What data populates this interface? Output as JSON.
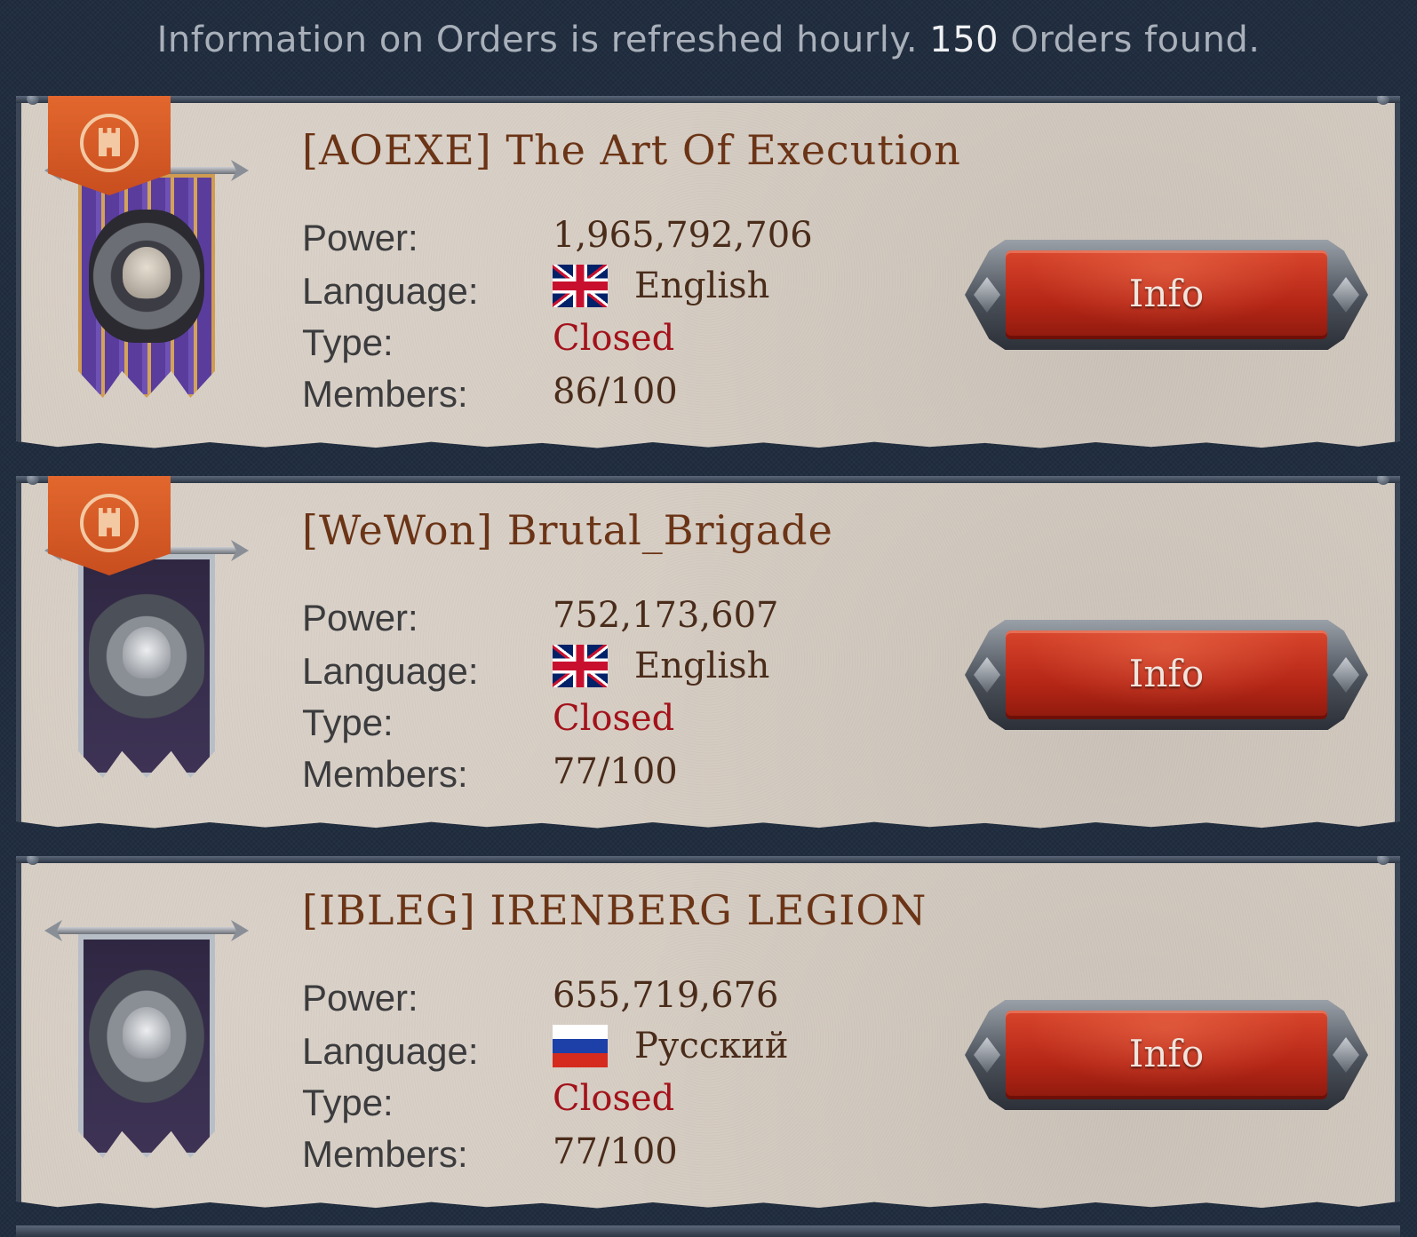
{
  "header": {
    "text_before": "Information on Orders is refreshed hourly.",
    "count": "150",
    "text_after": "Orders found."
  },
  "labels": {
    "power": "Power:",
    "language": "Language:",
    "type": "Type:",
    "members": "Members:"
  },
  "orders": [
    {
      "title": "[AOEXE] The Art Of Execution",
      "power": "1,965,792,706",
      "language": "English",
      "flag": "uk-flag-icon",
      "type": "Closed",
      "members": "86/100",
      "button": "Info",
      "banner": "skull-banner-icon",
      "has_castle_tab": true
    },
    {
      "title": "[WeWon] Brutal_Brigade",
      "power": "752,173,607",
      "language": "English",
      "flag": "uk-flag-icon",
      "type": "Closed",
      "members": "77/100",
      "button": "Info",
      "banner": "lion-banner-icon",
      "has_castle_tab": true
    },
    {
      "title": "[IBLEG] IRENBERG LEGION",
      "power": "655,719,676",
      "language": "Русский",
      "flag": "ru-flag-icon",
      "type": "Closed",
      "members": "77/100",
      "button": "Info",
      "banner": "wolf-banner-icon",
      "has_castle_tab": false
    }
  ],
  "colors": {
    "background": "#1f2c3e",
    "parchment": "#d6cdc3",
    "title": "#6b3416",
    "type_closed": "#a3121a",
    "button_red": "#c0301c",
    "tab_orange": "#d85a26"
  }
}
